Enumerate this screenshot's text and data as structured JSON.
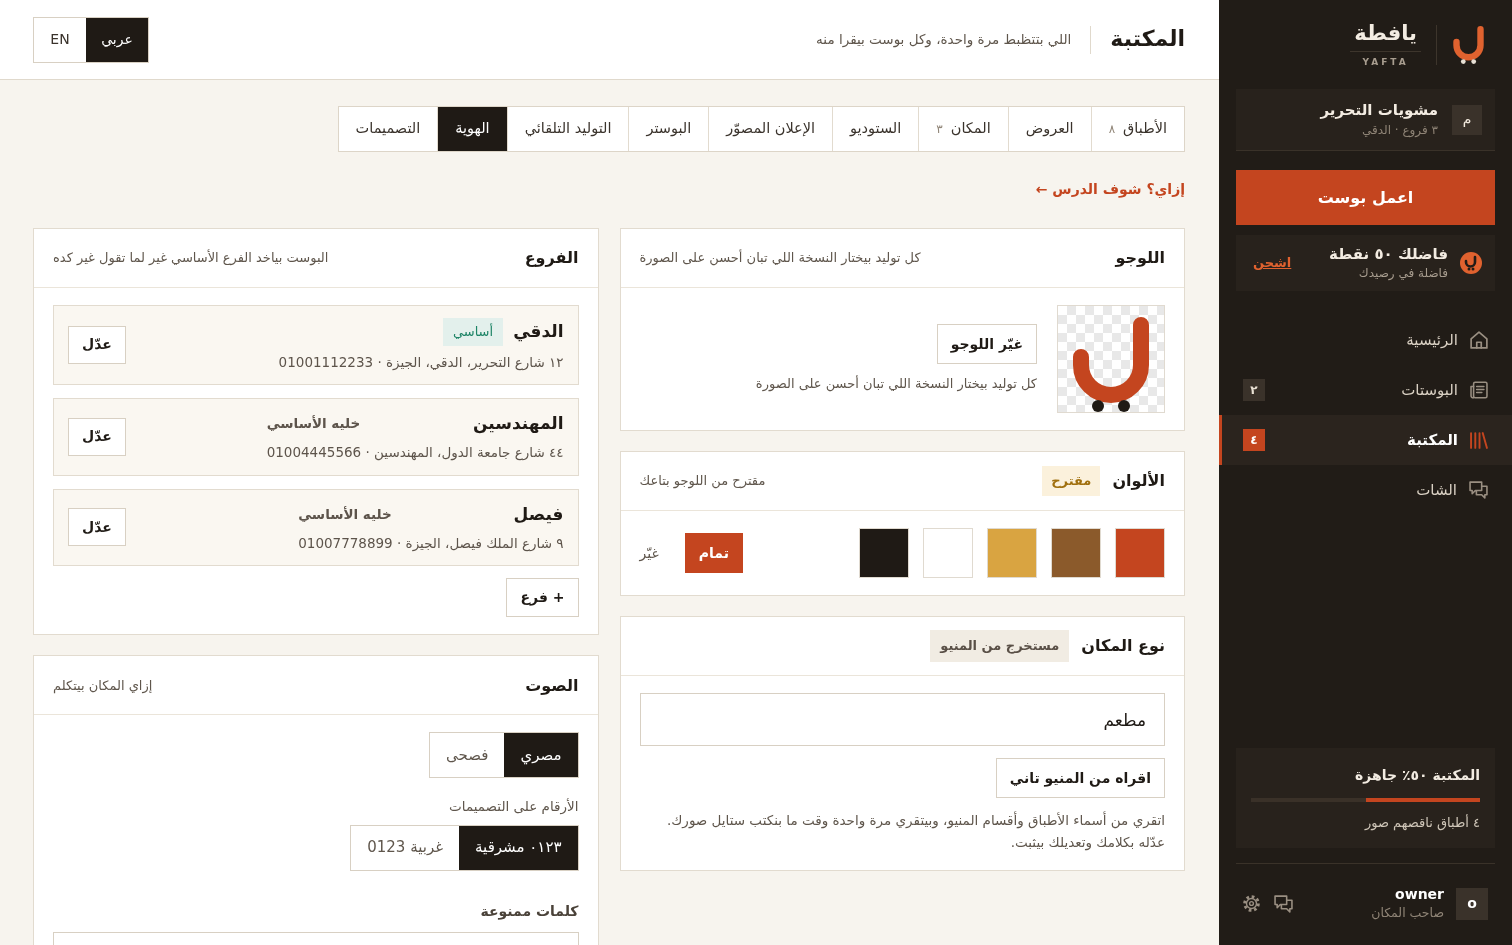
{
  "sidebar": {
    "brand": {
      "name": "يافطة",
      "latin": "YAFTA"
    },
    "venue": {
      "initial": "م",
      "name": "مشويات التحرير",
      "meta": "٣ فروع · الدقي"
    },
    "create_button": "اعمل بوست",
    "credits": {
      "title": "فاضلك ٥٠ نقطة",
      "subtitle": "فاضلة في رصيدك",
      "action": "اشحن"
    },
    "nav": [
      {
        "kind": "home",
        "label": "الرئيسية",
        "selected": false
      },
      {
        "kind": "posts",
        "label": "البوستات",
        "badge": "٢",
        "selected": false
      },
      {
        "kind": "library",
        "label": "المكتبة",
        "badge": "٤",
        "selected": true
      },
      {
        "kind": "chat",
        "label": "الشات",
        "selected": false
      }
    ],
    "readiness": {
      "title": "المكتبة ٥٠٪ جاهزة",
      "level": 0.5,
      "note": "٤ أطباق ناقصهم صور"
    },
    "user": {
      "initial": "o",
      "name": "owner",
      "role": "صاحب المكان"
    }
  },
  "header": {
    "title": "المكتبة",
    "subtitle": "اللي بتتظبط مرة واحدة، وكل بوست بيقرا منه",
    "languages": [
      {
        "label": "عربي",
        "selected": true
      },
      {
        "label": "EN",
        "selected": false
      }
    ]
  },
  "tabs": [
    {
      "label": "الأطباق",
      "count": "٨",
      "selected": false
    },
    {
      "label": "العروض",
      "selected": false
    },
    {
      "label": "المكان",
      "count": "٣",
      "selected": false
    },
    {
      "label": "الستوديو",
      "selected": false
    },
    {
      "label": "الإعلان المصوّر",
      "selected": false
    },
    {
      "label": "البوستر",
      "selected": false
    },
    {
      "label": "التوليد التلقائي",
      "selected": false
    },
    {
      "label": "الهوية",
      "selected": true
    },
    {
      "label": "التصميمات",
      "selected": false
    }
  ],
  "help_link": "إزاي؟ شوف الدرس ←",
  "logo": {
    "title": "اللوجو",
    "subtitle": "كل توليد بيختار النسخة اللي تبان أحسن على الصورة",
    "button": "غيّر اللوجو",
    "note": "كل توليد بيختار النسخة اللي تبان أحسن على الصورة"
  },
  "colors": {
    "title": "الألوان",
    "badge": "مقترح",
    "subtitle": "مقترح من اللوجو بتاعك",
    "swatches": [
      {
        "color": "#c4451f"
      },
      {
        "color": "#8b5a2b"
      },
      {
        "color": "#d9a441"
      },
      {
        "color": "#ffffff"
      },
      {
        "color": "#1f1a15"
      }
    ],
    "confirm_button": "تمام",
    "change_link": "غيّر"
  },
  "place_type": {
    "title": "نوع المكان",
    "badge": "مستخرج من المنيو",
    "value": "مطعم",
    "button": "اقراه من المنيو تاني",
    "note": "اتقري من أسماء الأطباق وأقسام المنيو، وبيتقري مرة واحدة وقت ما بنكتب ستايل صورك. عدّله بكلامك وتعديلك بيثبت."
  },
  "branches": {
    "title": "الفروع",
    "subtitle": "البوست بياخد الفرع الأساسي غير لما تقول غير كده",
    "items": [
      {
        "name": "الدقي",
        "primary": true,
        "tag": "أساسي",
        "address": "١٢ شارع التحرير، الدقي، الجيزة · 01001112233",
        "edit_button": "عدّل"
      },
      {
        "name": "المهندسين",
        "primary": false,
        "tag": "خليه الأساسي",
        "address": "٤٤ شارع جامعة الدول، المهندسين · 01004445566",
        "edit_button": "عدّل"
      },
      {
        "name": "فيصل",
        "primary": false,
        "tag": "خليه الأساسي",
        "address": "٩ شارع الملك فيصل، الجيزة · 01007778899",
        "edit_button": "عدّل"
      }
    ],
    "add_button": "+ فرع"
  },
  "voice": {
    "title": "الصوت",
    "subtitle": "إزاي المكان بيتكلم",
    "dialects": [
      {
        "label": "مصري",
        "selected": true
      },
      {
        "label": "فصحى",
        "selected": false
      }
    ],
    "numerals_label": "الأرقام على التصميمات",
    "numerals": [
      {
        "label": "٠١٢٣ مشرقية",
        "selected": true
      },
      {
        "label": "غربية 0123",
        "selected": false
      }
    ],
    "banned_words_label": "كلمات ممنوعة"
  }
}
